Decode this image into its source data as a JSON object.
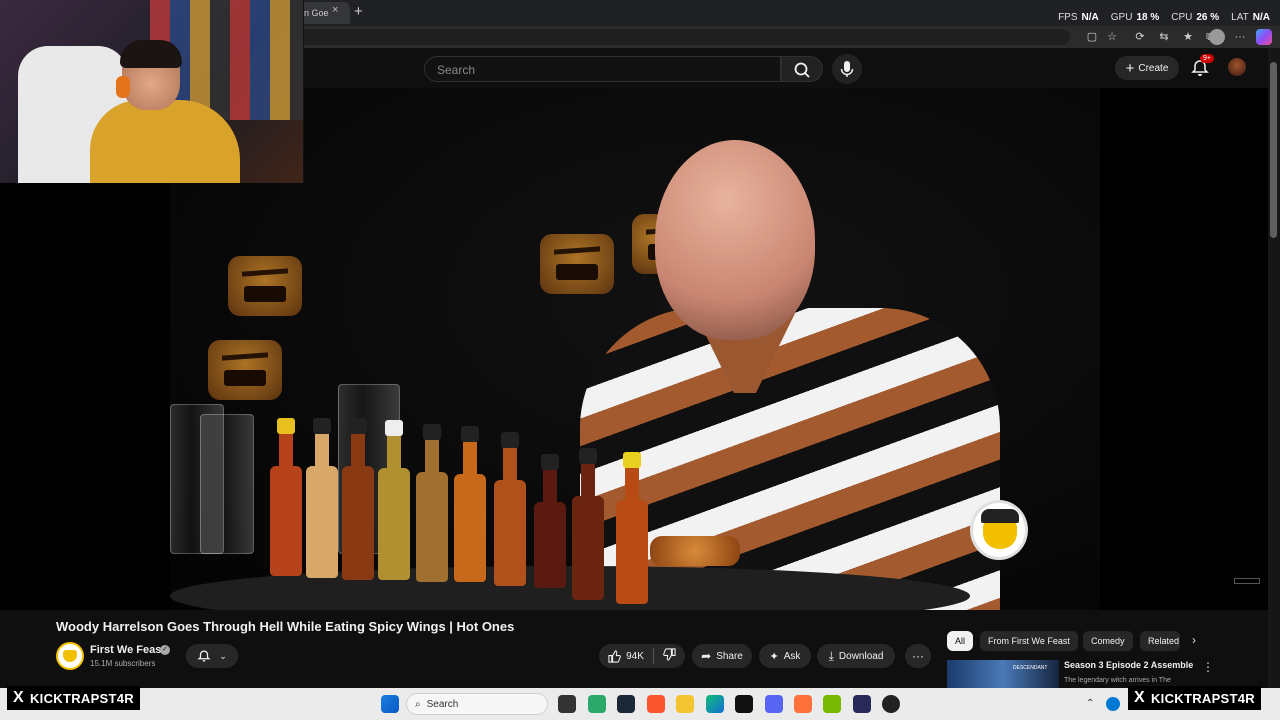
{
  "browser": {
    "tab_title": "n Goe",
    "tab_close": "×",
    "new_tab": "+",
    "stats": [
      {
        "label": "FPS",
        "value": "N/A"
      },
      {
        "label": "GPU",
        "value": "18 %"
      },
      {
        "label": "CPU",
        "value": "26 %"
      },
      {
        "label": "LAT",
        "value": "N/A"
      }
    ]
  },
  "header": {
    "search_placeholder": "Search",
    "create_label": "Create",
    "notification_count": "9+"
  },
  "video": {
    "title": "Woody Harrelson Goes Through Hell While Eating Spicy Wings | Hot Ones"
  },
  "channel": {
    "name": "First We Feast",
    "subscribers": "15.1M subscribers"
  },
  "actions": {
    "likes": "94K",
    "share": "Share",
    "ask": "Ask",
    "download": "Download",
    "more": "···"
  },
  "chips": [
    "All",
    "From First We Feast",
    "Comedy",
    "Related"
  ],
  "recommendation": {
    "title": "Season 3 Episode 2 Assemble",
    "subtitle": "The legendary witch arrives in The",
    "thumb_text": "DESCENDANT"
  },
  "taskbar": {
    "search_label": "Search"
  },
  "overlay": {
    "handle_left": "KICKTRAPST4R",
    "handle_right": "KICKTRAPST4R",
    "x_symbol": "X"
  },
  "colors": {
    "yt_bg": "#0f0f0f",
    "pill_bg": "#272727",
    "accent_red": "#cc0000",
    "chip_active": "#f1f1f1"
  }
}
